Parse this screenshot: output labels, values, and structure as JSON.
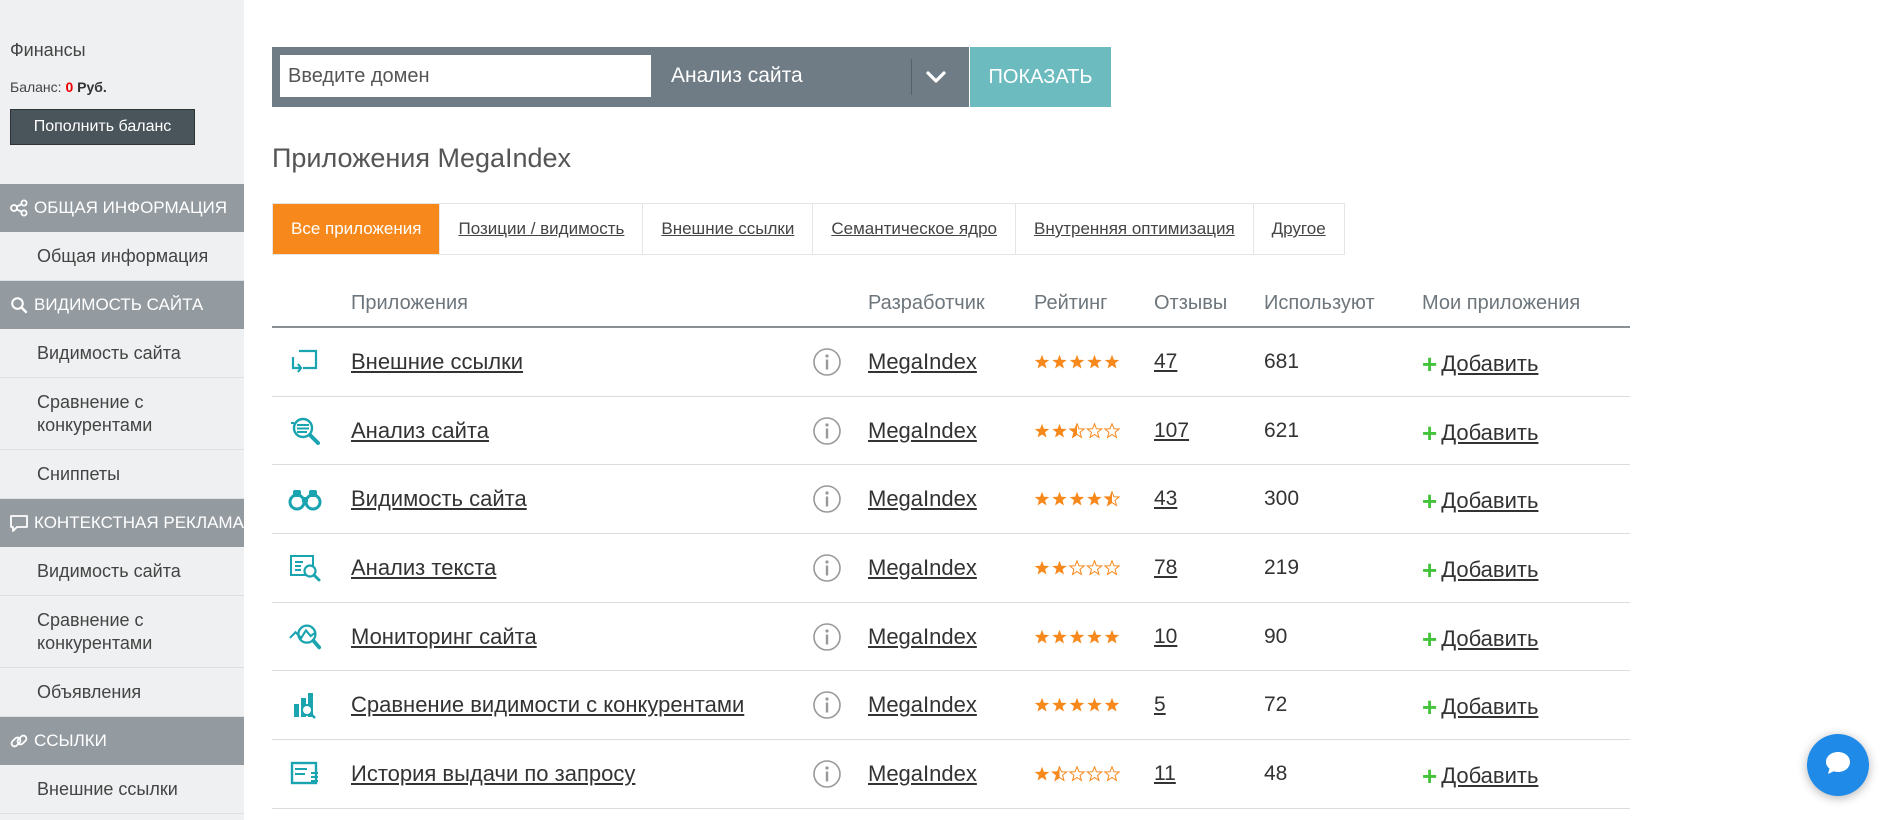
{
  "sidebar": {
    "finance_title": "Финансы",
    "balance_label": "Баланс:",
    "balance_amount": "0",
    "balance_currency": "Руб.",
    "topup_button": "Пополнить баланс",
    "sections": [
      {
        "icon": "share-nodes-icon",
        "title": "ОБЩАЯ ИНФОРМАЦИЯ",
        "items": [
          "Общая информация"
        ]
      },
      {
        "icon": "search-icon",
        "title": "ВИДИМОСТЬ САЙТА",
        "items": [
          "Видимость сайта",
          "Сравнение с конкурентами",
          "Сниппеты"
        ]
      },
      {
        "icon": "speech-bubble-icon",
        "title": "КОНТЕКСТНАЯ РЕКЛАМА",
        "items": [
          "Видимость сайта",
          "Сравнение с конкурентами",
          "Объявления"
        ]
      },
      {
        "icon": "link-icon",
        "title": "ССЫЛКИ",
        "items": [
          "Внешние ссылки"
        ]
      }
    ]
  },
  "search": {
    "placeholder": "Введите домен",
    "value": "",
    "selected_tool": "Анализ сайта",
    "show_button": "ПОКАЗАТЬ"
  },
  "page_title": "Приложения MegaIndex",
  "tabs": [
    "Все приложения",
    "Позиции / видимость",
    "Внешние ссылки",
    "Семантическое ядро",
    "Внутренняя оптимизация",
    "Другое"
  ],
  "active_tab": "Все приложения",
  "table": {
    "headers": {
      "apps": "Приложения",
      "developer": "Разработчик",
      "rating": "Рейтинг",
      "reviews": "Отзывы",
      "uses": "Используют",
      "my_apps": "Мои приложения"
    },
    "rows": [
      {
        "icon": "external-links-icon",
        "name": "Внешние ссылки",
        "developer": "MegaIndex",
        "rating": 5,
        "reviews": "47",
        "uses": "681",
        "action": "Добавить"
      },
      {
        "icon": "site-analysis-icon",
        "name": "Анализ сайта",
        "developer": "MegaIndex",
        "rating": 2.5,
        "reviews": "107",
        "uses": "621",
        "action": "Добавить"
      },
      {
        "icon": "binoculars-icon",
        "name": "Видимость сайта",
        "developer": "MegaIndex",
        "rating": 4.5,
        "reviews": "43",
        "uses": "300",
        "action": "Добавить"
      },
      {
        "icon": "text-analysis-icon",
        "name": "Анализ текста",
        "developer": "MegaIndex",
        "rating": 2,
        "reviews": "78",
        "uses": "219",
        "action": "Добавить"
      },
      {
        "icon": "monitoring-icon",
        "name": "Мониторинг сайта",
        "developer": "MegaIndex",
        "rating": 5,
        "reviews": "10",
        "uses": "90",
        "action": "Добавить"
      },
      {
        "icon": "competitor-compare-icon",
        "name": "Сравнение видимости с конкурентами",
        "developer": "MegaIndex",
        "rating": 5,
        "reviews": "5",
        "uses": "72",
        "action": "Добавить"
      },
      {
        "icon": "serp-history-icon",
        "name": "История выдачи по запросу",
        "developer": "MegaIndex",
        "rating": 1.5,
        "reviews": "11",
        "uses": "48",
        "action": "Добавить"
      }
    ]
  },
  "colors": {
    "accent_orange": "#f7891c",
    "teal": "#6cbcbf",
    "icon_teal": "#1aa4b0",
    "star": "#f7891c",
    "plus_green": "#46c33c",
    "chat_blue": "#1f8ae8"
  }
}
